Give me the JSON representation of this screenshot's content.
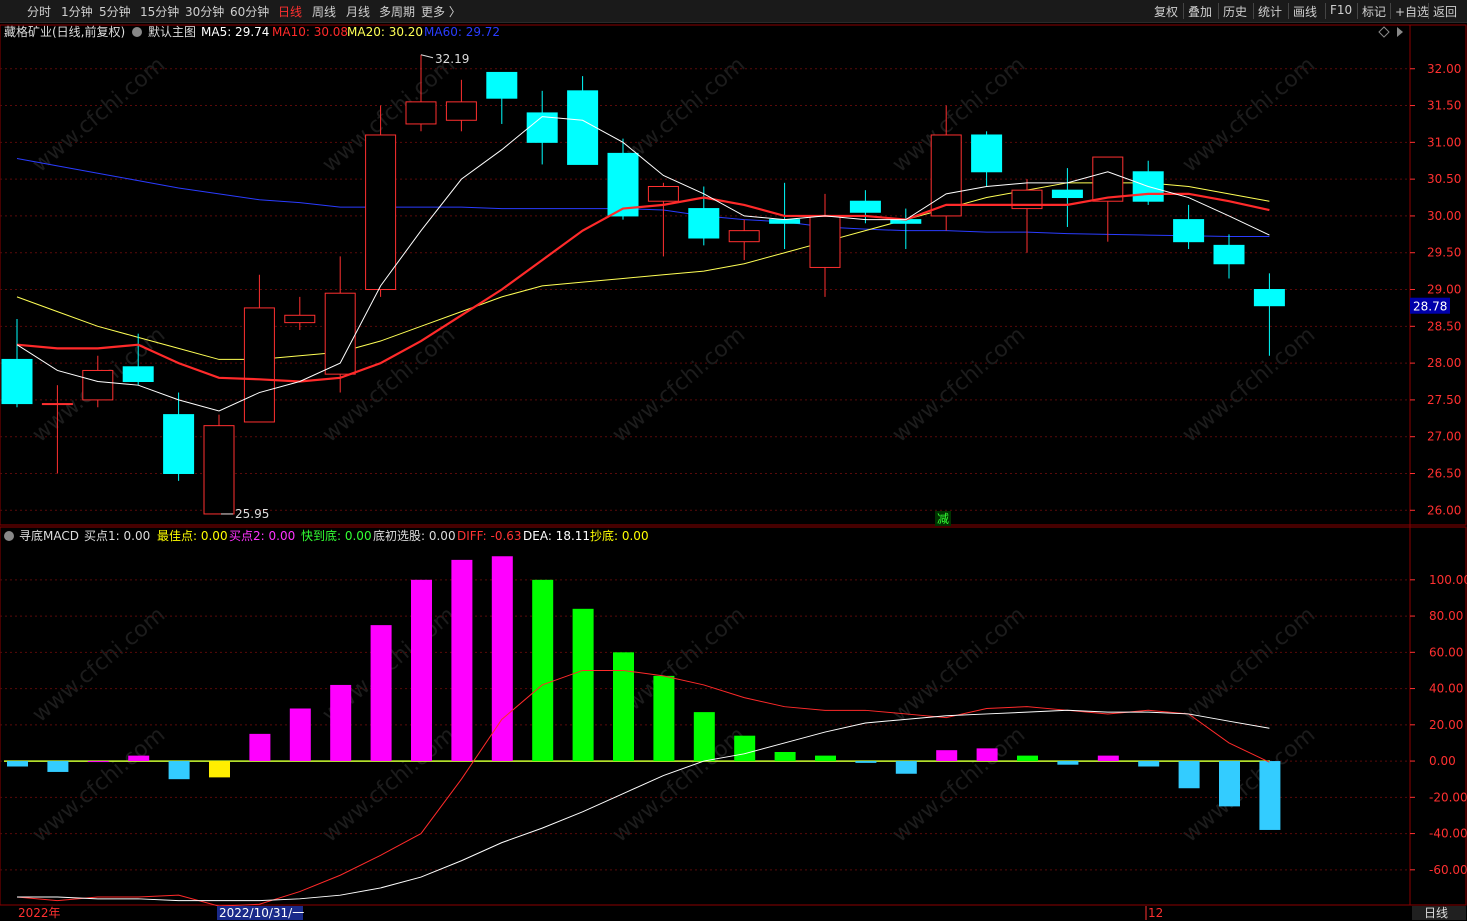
{
  "toolbar": {
    "periods": [
      "分时",
      "1分钟",
      "5分钟",
      "15分钟",
      "30分钟",
      "60分钟",
      "日线",
      "周线",
      "月线",
      "多周期",
      "更多 〉"
    ],
    "active_period": "日线",
    "right": [
      "复权",
      "叠加",
      "历史",
      "统计",
      "画线",
      "F10",
      "标记",
      "+自选",
      "返回"
    ]
  },
  "main_panel": {
    "stock_title": "藏格矿业(日线,前复权)",
    "template": "默认主图",
    "ma": [
      {
        "label": "MA5: 29.74",
        "color": "#ffffff"
      },
      {
        "label": "MA10: 30.08",
        "color": "#ff2a2a"
      },
      {
        "label": "MA20: 30.20",
        "color": "#ffff55"
      },
      {
        "label": "MA60: 29.72",
        "color": "#2a3cff"
      }
    ],
    "y_ticks": [
      "32.00",
      "31.50",
      "31.00",
      "30.50",
      "30.00",
      "29.50",
      "29.00",
      "28.50",
      "28.00",
      "27.50",
      "27.00",
      "26.50",
      "26.00"
    ],
    "current_price": "28.78",
    "high_label": "32.19",
    "low_label": "25.95",
    "signal_char": "减"
  },
  "indicator_panel": {
    "name": "寻底MACD",
    "params": [
      {
        "label": "买点1: 0.00",
        "color": "#dddddd"
      },
      {
        "label": "最佳点: 0.00",
        "color": "#ffff00"
      },
      {
        "label": "买点2: 0.00",
        "color": "#ff33ff"
      },
      {
        "label": "快到底: 0.00",
        "color": "#33ff33"
      },
      {
        "label": "底初选股: 0.00",
        "color": "#dddddd"
      },
      {
        "label": "DIFF: -0.63",
        "color": "#ff3333"
      },
      {
        "label": "DEA: 18.11",
        "color": "#ffffff"
      },
      {
        "label": "抄底: 0.00",
        "color": "#ffff00"
      }
    ],
    "y_ticks": [
      "100.00",
      "80.00",
      "60.00",
      "40.00",
      "20.00",
      "0.00",
      "-20.00",
      "-40.00",
      "-60.00"
    ]
  },
  "bottom_bar": {
    "year_label": "2022年",
    "date_label": "2022/10/31/一",
    "month_label": "12",
    "period_label": "日线"
  },
  "watermark": "www.cfchi.com",
  "colors": {
    "up": "#ff3030",
    "down": "#00ffff",
    "ma5": "#ffffff",
    "ma10": "#ff2a2a",
    "ma20": "#ffff55",
    "ma60": "#2a3cff",
    "macd_pos_rising": "#ff00ff",
    "macd_pos_falling": "#00ff00",
    "macd_neg": "#33ccff",
    "grid": "#5a0a0a",
    "axis": "#8b0000"
  },
  "chart_data": {
    "type": "candlestick",
    "candles": [
      {
        "o": 28.05,
        "c": 27.45,
        "h": 28.6,
        "l": 27.4
      },
      {
        "o": 27.45,
        "c": 27.45,
        "h": 27.7,
        "l": 26.5
      },
      {
        "o": 27.5,
        "c": 27.9,
        "h": 28.1,
        "l": 27.4
      },
      {
        "o": 27.95,
        "c": 27.75,
        "h": 28.4,
        "l": 27.7
      },
      {
        "o": 27.3,
        "c": 26.5,
        "h": 27.6,
        "l": 26.4
      },
      {
        "o": 25.95,
        "c": 27.15,
        "h": 27.3,
        "l": 25.95
      },
      {
        "o": 27.2,
        "c": 28.75,
        "h": 29.2,
        "l": 27.2
      },
      {
        "o": 28.55,
        "c": 28.65,
        "h": 28.9,
        "l": 28.45
      },
      {
        "o": 27.85,
        "c": 28.95,
        "h": 29.45,
        "l": 27.6
      },
      {
        "o": 29.0,
        "c": 31.1,
        "h": 31.5,
        "l": 28.9
      },
      {
        "o": 31.25,
        "c": 31.55,
        "h": 32.19,
        "l": 31.15
      },
      {
        "o": 31.3,
        "c": 31.55,
        "h": 31.85,
        "l": 31.15
      },
      {
        "o": 31.95,
        "c": 31.6,
        "h": 31.95,
        "l": 31.25
      },
      {
        "o": 31.4,
        "c": 31.0,
        "h": 31.7,
        "l": 30.7
      },
      {
        "o": 31.7,
        "c": 30.7,
        "h": 31.9,
        "l": 30.7
      },
      {
        "o": 30.85,
        "c": 30.0,
        "h": 31.05,
        "l": 29.95
      },
      {
        "o": 30.2,
        "c": 30.4,
        "h": 30.45,
        "l": 29.45
      },
      {
        "o": 30.1,
        "c": 29.7,
        "h": 30.4,
        "l": 29.6
      },
      {
        "o": 29.65,
        "c": 29.8,
        "h": 29.95,
        "l": 29.4
      },
      {
        "o": 29.95,
        "c": 29.9,
        "h": 30.45,
        "l": 29.55
      },
      {
        "o": 29.3,
        "c": 30.0,
        "h": 30.3,
        "l": 28.9
      },
      {
        "o": 30.2,
        "c": 30.05,
        "h": 30.35,
        "l": 29.9
      },
      {
        "o": 29.95,
        "c": 29.9,
        "h": 30.1,
        "l": 29.55
      },
      {
        "o": 30.0,
        "c": 31.1,
        "h": 31.5,
        "l": 29.8
      },
      {
        "o": 31.1,
        "c": 30.6,
        "h": 31.15,
        "l": 30.4
      },
      {
        "o": 30.1,
        "c": 30.35,
        "h": 30.5,
        "l": 29.5
      },
      {
        "o": 30.35,
        "c": 30.25,
        "h": 30.65,
        "l": 29.85
      },
      {
        "o": 30.2,
        "c": 30.8,
        "h": 30.8,
        "l": 29.65
      },
      {
        "o": 30.6,
        "c": 30.2,
        "h": 30.75,
        "l": 30.15
      },
      {
        "o": 29.95,
        "c": 29.65,
        "h": 30.15,
        "l": 29.55
      },
      {
        "o": 29.6,
        "c": 29.35,
        "h": 29.75,
        "l": 29.15
      },
      {
        "o": 29.0,
        "c": 28.78,
        "h": 29.22,
        "l": 28.1
      }
    ],
    "ma5": [
      28.25,
      27.9,
      27.75,
      27.7,
      27.5,
      27.35,
      27.6,
      27.75,
      28.0,
      29.05,
      29.8,
      30.5,
      30.9,
      31.35,
      31.3,
      31.0,
      30.55,
      30.3,
      30.0,
      29.95,
      30.0,
      29.95,
      29.95,
      30.3,
      30.4,
      30.45,
      30.45,
      30.6,
      30.4,
      30.25,
      30.0,
      29.74
    ],
    "ma10": [
      28.25,
      28.2,
      28.2,
      28.25,
      28.0,
      27.8,
      27.78,
      27.75,
      27.8,
      28.0,
      28.3,
      28.65,
      29.0,
      29.4,
      29.8,
      30.1,
      30.15,
      30.25,
      30.15,
      30.0,
      30.0,
      30.0,
      29.95,
      30.15,
      30.15,
      30.15,
      30.15,
      30.25,
      30.3,
      30.3,
      30.2,
      30.08
    ],
    "ma20": [
      28.9,
      28.7,
      28.5,
      28.35,
      28.2,
      28.05,
      28.05,
      28.1,
      28.15,
      28.3,
      28.5,
      28.7,
      28.9,
      29.05,
      29.1,
      29.15,
      29.2,
      29.25,
      29.35,
      29.5,
      29.65,
      29.8,
      29.95,
      30.1,
      30.25,
      30.35,
      30.45,
      30.45,
      30.45,
      30.4,
      30.3,
      30.2
    ],
    "ma60": [
      30.78,
      30.68,
      30.58,
      30.48,
      30.38,
      30.3,
      30.22,
      30.18,
      30.12,
      30.12,
      30.12,
      30.12,
      30.1,
      30.1,
      30.1,
      30.1,
      30.08,
      30.0,
      29.95,
      29.92,
      29.85,
      29.82,
      29.8,
      29.8,
      29.78,
      29.78,
      29.76,
      29.75,
      29.74,
      29.73,
      29.72,
      29.72
    ],
    "macd_hist": [
      -3,
      -6,
      0,
      3,
      -10,
      -9,
      15,
      29,
      42,
      75,
      100,
      111,
      113,
      100,
      84,
      60,
      47,
      27,
      14,
      5,
      3,
      -1,
      -7,
      6,
      7,
      3,
      -2,
      3,
      -3,
      -15,
      -25,
      -38
    ],
    "diff": [
      -75,
      -77,
      -75,
      -75,
      -74,
      -80,
      -79,
      -72,
      -63,
      -52,
      -40,
      -10,
      23,
      42,
      50,
      50,
      47,
      42,
      35,
      30,
      28,
      28,
      26,
      24,
      29,
      30,
      28,
      26,
      28,
      26,
      10,
      -0.63
    ],
    "dea": [
      -75,
      -75,
      -76,
      -76,
      -77,
      -77,
      -77,
      -76,
      -74,
      -70,
      -64,
      -55,
      -45,
      -37,
      -28,
      -18,
      -8,
      0,
      4,
      10,
      16,
      21,
      23,
      25,
      26,
      27,
      28,
      27,
      27,
      26,
      22,
      18.11
    ],
    "ylim_price": [
      25.8,
      32.35
    ],
    "ylim_macd": [
      -75,
      117
    ]
  }
}
